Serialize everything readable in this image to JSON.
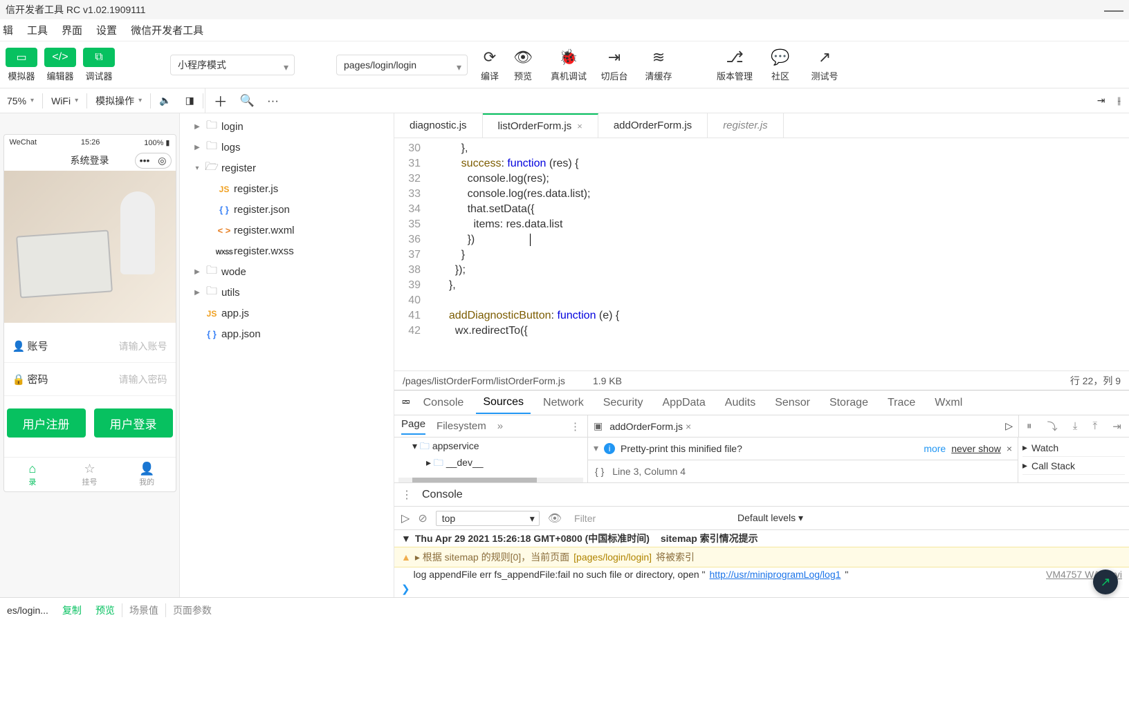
{
  "window": {
    "title": "信开发者工具 RC v1.02.1909111"
  },
  "menubar": {
    "items": [
      "辑",
      "工具",
      "界面",
      "设置",
      "微信开发者工具"
    ]
  },
  "toolbar": {
    "modes": [
      {
        "label": "模拟器",
        "icon": "▭"
      },
      {
        "label": "编辑器",
        "icon": "</>"
      },
      {
        "label": "调试器",
        "icon": "⧉"
      }
    ],
    "appMode": "小程序模式",
    "pagePath": "pages/login/login",
    "actions": [
      {
        "label": "编译",
        "icon": "⟳"
      },
      {
        "label": "预览",
        "icon": "◉"
      },
      {
        "label": "真机调试",
        "icon": "🐞"
      },
      {
        "label": "切后台",
        "icon": "⇥"
      },
      {
        "label": "清缓存",
        "icon": "≋"
      },
      {
        "label": "版本管理",
        "icon": "⎇"
      },
      {
        "label": "社区",
        "icon": "💬"
      },
      {
        "label": "测试号",
        "icon": "↗"
      }
    ]
  },
  "secondbar": {
    "zoom": "75%",
    "network": "WiFi",
    "operation": "模拟操作"
  },
  "phone": {
    "status": {
      "carrier": "WeChat",
      "time": "15:26",
      "battery": "100%"
    },
    "navTitle": "系统登录",
    "fields": [
      {
        "icon": "👤",
        "label": "账号",
        "placeholder": "请输入账号"
      },
      {
        "icon": "🔒",
        "label": "密码",
        "placeholder": "请输入密码"
      }
    ],
    "buttons": [
      "用户注册",
      "用户登录"
    ],
    "tabs": [
      {
        "icon": "⌂",
        "label": "录",
        "active": true
      },
      {
        "icon": "☆",
        "label": "挂号"
      },
      {
        "icon": "👤",
        "label": "我的"
      }
    ]
  },
  "tree": [
    {
      "indent": 1,
      "type": "folder",
      "name": "login",
      "arrow": "▶"
    },
    {
      "indent": 1,
      "type": "folder",
      "name": "logs",
      "arrow": "▶"
    },
    {
      "indent": 1,
      "type": "folder-open",
      "name": "register",
      "arrow": "▾"
    },
    {
      "indent": 2,
      "type": "js",
      "name": "register.js"
    },
    {
      "indent": 2,
      "type": "json",
      "name": "register.json"
    },
    {
      "indent": 2,
      "type": "wxml",
      "name": "register.wxml"
    },
    {
      "indent": 2,
      "type": "wxss",
      "name": "register.wxss"
    },
    {
      "indent": 1,
      "type": "folder",
      "name": "wode",
      "arrow": "▶"
    },
    {
      "indent": 1,
      "type": "folder",
      "name": "utils",
      "arrow": "▶"
    },
    {
      "indent": 1,
      "type": "js",
      "name": "app.js"
    },
    {
      "indent": 1,
      "type": "json",
      "name": "app.json"
    }
  ],
  "editorTabs": [
    {
      "label": "diagnostic.js",
      "active": false
    },
    {
      "label": "listOrderForm.js",
      "active": true,
      "close": true
    },
    {
      "label": "addOrderForm.js",
      "active": false
    },
    {
      "label": "register.js",
      "active": false,
      "italic": true
    }
  ],
  "code": {
    "startLine": 30,
    "lines": [
      "      },",
      "      success: function (res) {",
      "        console.log(res);",
      "        console.log(res.data.list);",
      "        that.setData({",
      "          items: res.data.list",
      "        })",
      "      }",
      "    });",
      "  },",
      "",
      "  addDiagnosticButton: function (e) {",
      "    wx.redirectTo({"
    ],
    "statusPath": "/pages/listOrderForm/listOrderForm.js",
    "statusSize": "1.9 KB",
    "statusPos": "行 22，列 9"
  },
  "devtools": {
    "tabs": [
      "Console",
      "Sources",
      "Network",
      "Security",
      "AppData",
      "Audits",
      "Sensor",
      "Storage",
      "Trace",
      "Wxml"
    ],
    "activeTab": "Sources",
    "row2": {
      "left": [
        "Page",
        "Filesystem"
      ],
      "midFile": "addOrderForm.js"
    },
    "tree": [
      {
        "name": "appservice",
        "indent": 1,
        "arrow": "▾"
      },
      {
        "name": "__dev__",
        "indent": 2,
        "arrow": "▸"
      }
    ],
    "pretty": {
      "msg": "Pretty-print this minified file?",
      "more": "more",
      "never": "never show"
    },
    "linecol": "Line 3, Column 4",
    "watch": "Watch",
    "callstack": "Call Stack",
    "consoleLabel": "Console",
    "filter": {
      "context": "top",
      "placeholder": "Filter",
      "levels": "Default levels"
    },
    "log1": {
      "time": "Thu Apr 29 2021 15:26:18 GMT+0800 (中国标准时间)",
      "tag": "sitemap 索引情况提示"
    },
    "log2": {
      "prefix": "▸ 根据 sitemap 的规则[0]，当前页面 ",
      "page": "[pages/login/login]",
      "suffix": " 将被索引"
    },
    "log3": {
      "text": "log appendFile err fs_appendFile:fail no such file or directory, open \"",
      "url": "http://usr/miniprogramLog/log1",
      "vm": "VM4757 WAServi"
    }
  },
  "bottombar": {
    "path": "es/login...",
    "copy": "复制",
    "preview": "预览",
    "scene": "场景值",
    "params": "页面参数"
  }
}
